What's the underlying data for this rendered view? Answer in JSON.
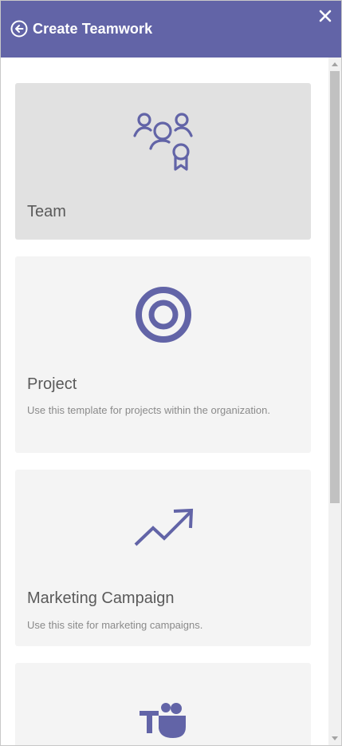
{
  "header": {
    "title": "Create Teamwork",
    "back_icon": "back-arrow-circle-icon",
    "close_icon": "close-icon",
    "background_color": "#6264a7"
  },
  "templates": [
    {
      "title": "Team",
      "description": "",
      "icon": "team-people-badge-icon",
      "selected": true
    },
    {
      "title": "Project",
      "description": "Use this template for projects within the organization.",
      "icon": "target-icon",
      "selected": false
    },
    {
      "title": "Marketing Campaign",
      "description": "Use this site for marketing campaigns.",
      "icon": "trending-up-arrow-icon",
      "selected": false
    },
    {
      "title": "",
      "description": "",
      "icon": "microsoft-teams-icon",
      "selected": false
    }
  ],
  "colors": {
    "accent": "#6264a7",
    "card": "#f4f4f4",
    "card_selected": "#e1e1e1"
  }
}
